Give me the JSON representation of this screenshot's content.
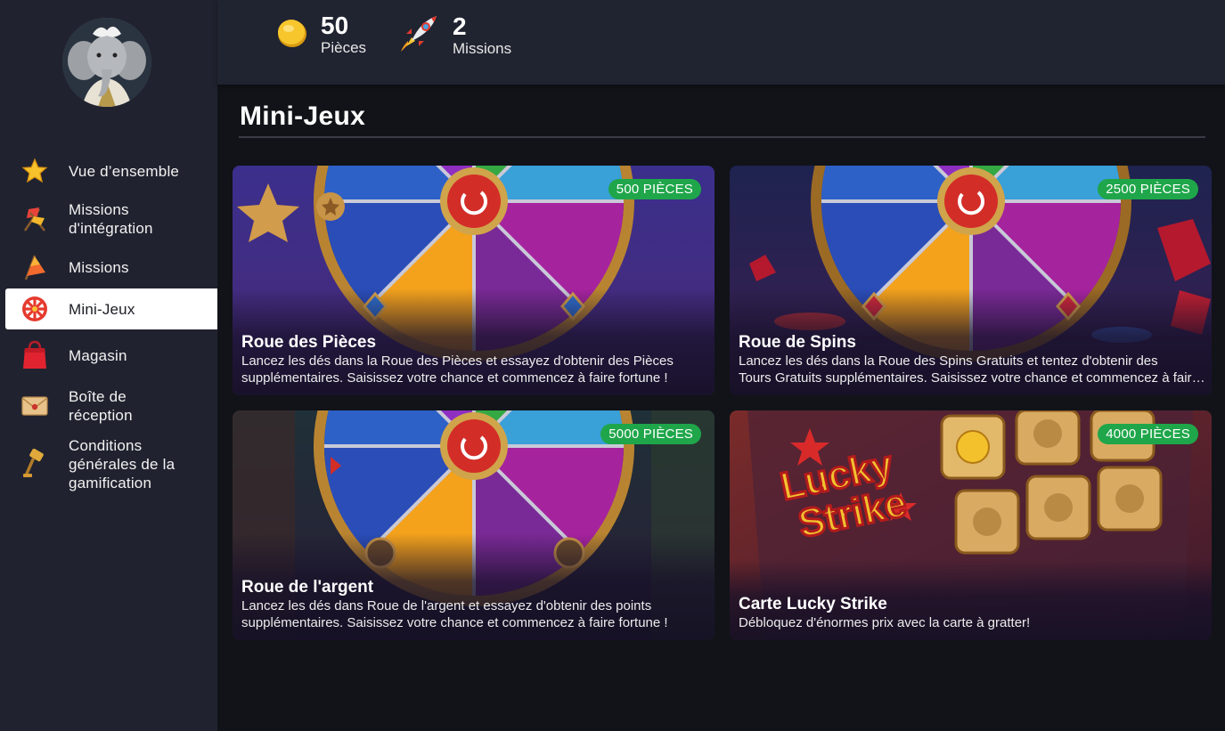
{
  "sidebar": {
    "items": [
      {
        "label": "Vue d’ensemble",
        "icon": "star-icon"
      },
      {
        "label": "Missions\nd'intégration",
        "icon": "flags-icon"
      },
      {
        "label": "Missions",
        "icon": "flag-icon"
      },
      {
        "label": "Mini-Jeux",
        "icon": "wheel-icon",
        "active": true
      },
      {
        "label": "Magasin",
        "icon": "shopping-bag-icon"
      },
      {
        "label": "Boîte de\nréception",
        "icon": "envelope-icon"
      },
      {
        "label": "Conditions\ngénérales de la\ngamification",
        "icon": "gavel-icon"
      }
    ]
  },
  "header": {
    "coins": {
      "value": "50",
      "label": "Pièces",
      "icon": "coin-icon"
    },
    "missions": {
      "value": "2",
      "label": "Missions",
      "icon": "rocket-icon"
    }
  },
  "main": {
    "title": "Mini-Jeux",
    "cards": [
      {
        "title": "Roue des Pièces",
        "price": "500 PIÈCES",
        "desc1": "Lancez les dés dans la Roue des Pièces et essayez d'obtenir des Pièces",
        "desc2": "supplémentaires. Saisissez votre chance et commencez à faire fortune !"
      },
      {
        "title": "Roue de Spins",
        "price": "2500 PIÈCES",
        "desc1": "Lancez les dés dans la Roue des Spins Gratuits et tentez d'obtenir des",
        "desc2": "Tours Gratuits supplémentaires. Saisissez votre chance et commencez à faire fortune !"
      },
      {
        "title": "Roue de l'argent",
        "price": "5000 PIÈCES",
        "desc1": "Lancez les dés dans Roue de l'argent et essayez d'obtenir des points",
        "desc2": "supplémentaires. Saisissez votre chance et commencez à faire fortune !"
      },
      {
        "title": "Carte Lucky Strike",
        "price": "4000 PIÈCES",
        "desc1": "Débloquez d'énormes prix avec la carte à gratter!",
        "desc2": "",
        "art_text": [
          "Lucky",
          "Strike"
        ]
      }
    ]
  },
  "colors": {
    "badge": "#1fa64a",
    "sidebar": "#20232f",
    "topbar": "#202330",
    "background": "#111318"
  }
}
